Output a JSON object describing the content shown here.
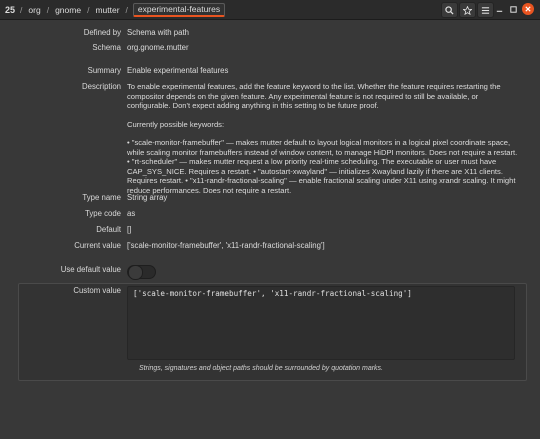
{
  "header": {
    "root_icon_label": "25",
    "path": [
      "org",
      "gnome",
      "mutter"
    ],
    "separator": "/",
    "active_segment": "experimental-features",
    "search_icon": "search-icon",
    "bookmark_icon": "star-icon",
    "menu_icon": "hamburger-menu-icon",
    "minimize_icon": "minimize-icon",
    "maximize_icon": "maximize-icon",
    "close_icon": "close-icon",
    "accent_color": "#e95420"
  },
  "rows": {
    "defined_by": {
      "label": "Defined by",
      "value": "Schema with path"
    },
    "schema": {
      "label": "Schema",
      "value": "org.gnome.mutter"
    },
    "summary": {
      "label": "Summary",
      "value": "Enable experimental features"
    },
    "description": {
      "label": "Description",
      "para1": "To enable experimental features, add the feature keyword to the list. Whether the feature requires restarting the compositor depends on the given feature. Any experimental feature is not required to still be available, or configurable. Don't expect adding anything in this setting to be future proof.",
      "para2": "Currently possible keywords:",
      "para3": "• \"scale-monitor-framebuffer\" — makes mutter default to layout logical monitors in a logical pixel coordinate space, while scaling monitor framebuffers instead of window content, to manage HiDPI monitors. Does not require a restart. • \"rt-scheduler\" — makes mutter request a low priority real-time scheduling. The executable or user must have CAP_SYS_NICE. Requires a restart. • \"autostart-xwayland\" — initializes Xwayland lazily if there are X11 clients. Requires restart. • \"x11-randr-fractional-scaling\" — enable fractional scaling under X11 using xrandr scaling. It might reduce performances. Does not require a restart."
    },
    "type_name": {
      "label": "Type name",
      "value": "String array"
    },
    "type_code": {
      "label": "Type code",
      "value": "as"
    },
    "default": {
      "label": "Default",
      "value": "[]"
    },
    "current_value": {
      "label": "Current value",
      "value": "['scale-monitor-framebuffer', 'x11-randr-fractional-scaling']"
    },
    "use_default": {
      "label": "Use default value",
      "on": false
    },
    "custom_value": {
      "label": "Custom value",
      "value": "['scale-monitor-framebuffer', 'x11-randr-fractional-scaling']",
      "hint": "Strings, signatures and object paths should be surrounded by quotation marks."
    }
  }
}
